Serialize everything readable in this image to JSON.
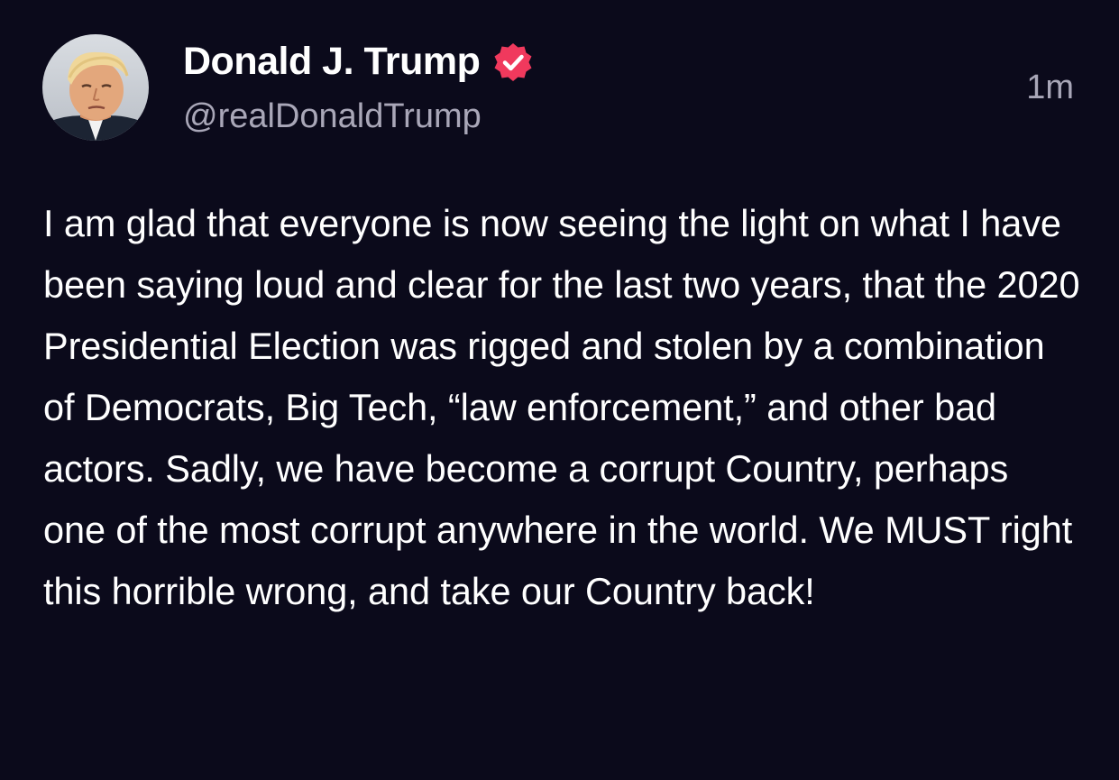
{
  "post": {
    "author": {
      "display_name": "Donald J. Trump",
      "handle": "@realDonaldTrump",
      "verified": true,
      "avatar_icon": "profile-photo",
      "verified_icon": "verified-badge-icon"
    },
    "timestamp": "1m",
    "text": "I am glad that everyone is now seeing the light on what I have been saying loud and clear for the last two years, that the 2020 Presidential Election was rigged and stolen by a combination of Democrats, Big Tech, “law enforcement,” and other bad actors. Sadly, we have become a corrupt Country, perhaps one of the most corrupt anywhere in the world. We MUST right this horrible wrong, and take our Country back!"
  },
  "colors": {
    "background": "#0b0a1b",
    "primary_text": "#ffffff",
    "secondary_text": "#a9a7b8",
    "verified_badge": "#f0395d"
  }
}
